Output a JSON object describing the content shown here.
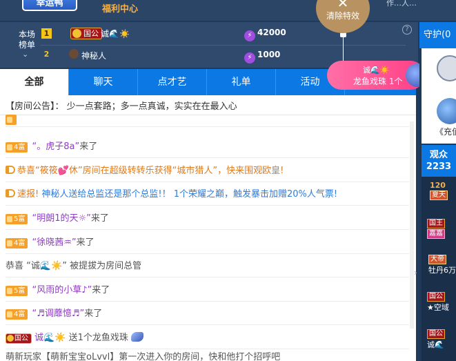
{
  "top": {
    "lucky_label": "幸运鸭",
    "welfare_label": "福利中心",
    "right_text": "作…人…"
  },
  "effects": {
    "clear_label": "清除特效"
  },
  "rank": {
    "title": "本场榜单",
    "rows": [
      {
        "rank": "1",
        "badge": "国公",
        "name": "诚🌊☀️",
        "score": "42000"
      },
      {
        "rank": "2",
        "name": "神秘人",
        "score": "1000"
      }
    ]
  },
  "dragon_gift": {
    "name": "诚🌊☀️",
    "gift": "龙鱼戏珠",
    "count": "1个"
  },
  "tabs": [
    "全部",
    "聊天",
    "点才艺",
    "礼单",
    "活动"
  ],
  "notice": "【房间公告】： 少一点套路；多一点真诚，实实在在最入心",
  "messages": [
    {
      "type": "enter",
      "level": "4富",
      "name": "“。虎子8a”",
      "suffix": "来了"
    },
    {
      "type": "horn",
      "text": "恭喜“筱筱💕休”房间在超级转转乐获得“城市猎人”，快来围观欧皇!"
    },
    {
      "type": "speed",
      "label": "速报!",
      "text": "神秘人送给总监还是那个总监!！ 1个荣耀之巅，触发暴击加赠20%人气票!"
    },
    {
      "type": "enter",
      "level": "5富",
      "name": "“明朗1的天☼”",
      "suffix": "来了"
    },
    {
      "type": "enter",
      "level": "4富",
      "name": "“徐晓茜♒”",
      "suffix": "来了"
    },
    {
      "type": "promote",
      "text": "恭喜 “诚🌊☀️” 被提拔为房间总管"
    },
    {
      "type": "enter",
      "level": "5富",
      "name": "“风雨的小草♪”",
      "suffix": "来了"
    },
    {
      "type": "enter",
      "level": "4富",
      "name": "“♬调蘼憶♬”",
      "suffix": "来了"
    },
    {
      "type": "gift",
      "badge": "国公",
      "name": "诚🌊☀️",
      "text": "送1个龙鱼戏珠"
    },
    {
      "type": "partial",
      "text": "萌新玩家【萌新宝宝oLvvl】第一次进入你的房间，快和他打个招呼吧"
    }
  ],
  "right": {
    "guard_label": "守护(0",
    "guard_sub": "《充值",
    "audience_label": "观众",
    "audience_count": "2233",
    "items": [
      {
        "tag": "120",
        "extra": "夏天"
      },
      {
        "tag": "国王",
        "extra": "嘉嘉"
      },
      {
        "tag": "大帝",
        "extra": "牡丹6万"
      },
      {
        "tag": "国公",
        "extra": "★空域"
      },
      {
        "tag": "国公",
        "extra": "诚🌊"
      }
    ]
  },
  "colors": {
    "tab_blue": "#0b78e3",
    "wealth_orange": "#f4a02a",
    "name_purple": "#8e3cc4",
    "link_blue": "#2f7bd8",
    "pink_pill": "#ff3f86"
  }
}
